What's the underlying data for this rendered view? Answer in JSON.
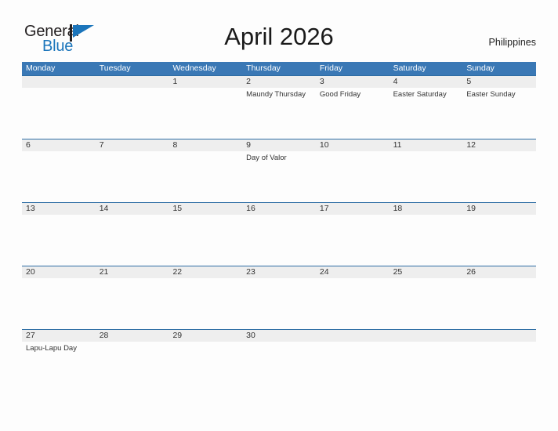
{
  "brand": {
    "word_one": "General",
    "word_two": "Blue",
    "mark": "flag-triangle-icon",
    "color_dark": "#231f20",
    "color_blue": "#1b75bb"
  },
  "header": {
    "title": "April 2026",
    "country": "Philippines"
  },
  "theme": {
    "header_blue": "#3a78b5",
    "rule_blue": "#2e6da4",
    "band_gray": "#eeeeee",
    "page_background": "#fdfdfd",
    "text": "#333333"
  },
  "calendar": {
    "weekdays": [
      "Monday",
      "Tuesday",
      "Wednesday",
      "Thursday",
      "Friday",
      "Saturday",
      "Sunday"
    ],
    "weeks": [
      [
        {
          "num": "",
          "event": ""
        },
        {
          "num": "",
          "event": ""
        },
        {
          "num": "1",
          "event": ""
        },
        {
          "num": "2",
          "event": "Maundy Thursday"
        },
        {
          "num": "3",
          "event": "Good Friday"
        },
        {
          "num": "4",
          "event": "Easter Saturday"
        },
        {
          "num": "5",
          "event": "Easter Sunday"
        }
      ],
      [
        {
          "num": "6",
          "event": ""
        },
        {
          "num": "7",
          "event": ""
        },
        {
          "num": "8",
          "event": ""
        },
        {
          "num": "9",
          "event": "Day of Valor"
        },
        {
          "num": "10",
          "event": ""
        },
        {
          "num": "11",
          "event": ""
        },
        {
          "num": "12",
          "event": ""
        }
      ],
      [
        {
          "num": "13",
          "event": ""
        },
        {
          "num": "14",
          "event": ""
        },
        {
          "num": "15",
          "event": ""
        },
        {
          "num": "16",
          "event": ""
        },
        {
          "num": "17",
          "event": ""
        },
        {
          "num": "18",
          "event": ""
        },
        {
          "num": "19",
          "event": ""
        }
      ],
      [
        {
          "num": "20",
          "event": ""
        },
        {
          "num": "21",
          "event": ""
        },
        {
          "num": "22",
          "event": ""
        },
        {
          "num": "23",
          "event": ""
        },
        {
          "num": "24",
          "event": ""
        },
        {
          "num": "25",
          "event": ""
        },
        {
          "num": "26",
          "event": ""
        }
      ],
      [
        {
          "num": "27",
          "event": "Lapu-Lapu Day"
        },
        {
          "num": "28",
          "event": ""
        },
        {
          "num": "29",
          "event": ""
        },
        {
          "num": "30",
          "event": ""
        },
        {
          "num": "",
          "event": ""
        },
        {
          "num": "",
          "event": ""
        },
        {
          "num": "",
          "event": ""
        }
      ]
    ]
  }
}
